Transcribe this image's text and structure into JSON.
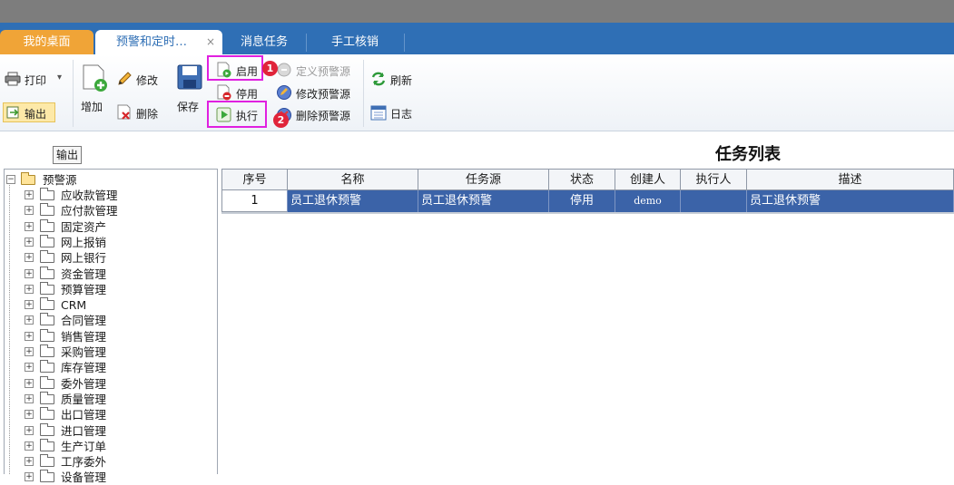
{
  "tabs": {
    "home": "我的桌面",
    "active": "预警和定时…",
    "active_close": "×",
    "t3": "消息任务",
    "t4": "手工核销"
  },
  "toolbar": {
    "print": "打印",
    "print_arrow": "▾",
    "export": "输出",
    "add": "增加",
    "modify": "修改",
    "delete": "删除",
    "save": "保存",
    "enable": "启用",
    "disable": "停用",
    "execute": "执行",
    "define_source": "定义预警源",
    "modify_source": "修改预警源",
    "delete_source": "删除预警源",
    "refresh": "刷新",
    "log": "日志"
  },
  "annotations": {
    "badge1": "1",
    "badge2": "2",
    "highlight_color": "#e020e0",
    "badge_color": "#e0243a"
  },
  "panel": {
    "export_label": "输出",
    "title": "任务列表"
  },
  "tree": {
    "root": "预警源",
    "items": [
      "应收款管理",
      "应付款管理",
      "固定资产",
      "网上报销",
      "网上银行",
      "资金管理",
      "预算管理",
      "CRM",
      "合同管理",
      "销售管理",
      "采购管理",
      "库存管理",
      "委外管理",
      "质量管理",
      "出口管理",
      "进口管理",
      "生产订单",
      "工序委外",
      "设备管理"
    ]
  },
  "grid": {
    "columns": [
      "序号",
      "名称",
      "任务源",
      "状态",
      "创建人",
      "执行人",
      "描述"
    ],
    "rows": [
      [
        "1",
        "员工退休预警",
        "员工退休预警",
        "停用",
        "demo",
        "",
        "员工退休预警"
      ]
    ],
    "selected_row_color": "#3b63a8"
  },
  "colors": {
    "tabbar": "#2f6fb5",
    "home_tab": "#f0a437",
    "topbar": "#7d7d7d"
  }
}
